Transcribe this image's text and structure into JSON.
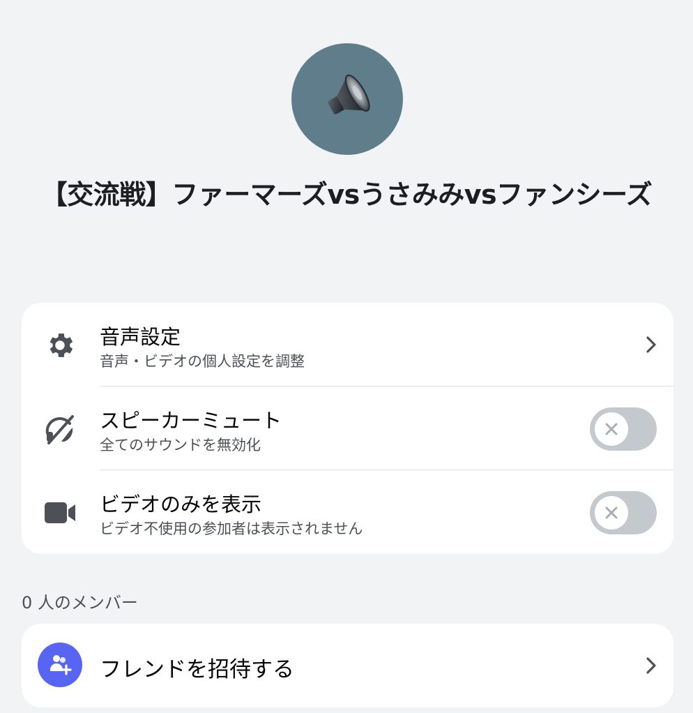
{
  "channel": {
    "title": "【交流戦】ファーマーズvsうさみみvsファンシーズ",
    "icon": "speaker-icon",
    "avatar_color": "#607d8b"
  },
  "settings": [
    {
      "title": "音声設定",
      "subtitle": "音声・ビデオの個人設定を調整",
      "icon": "gear-icon",
      "control": "chevron"
    },
    {
      "title": "スピーカーミュート",
      "subtitle": "全てのサウンドを無効化",
      "icon": "speaker-muted-icon",
      "control": "toggle",
      "enabled": false
    },
    {
      "title": "ビデオのみを表示",
      "subtitle": "ビデオ不使用の参加者は表示されません",
      "icon": "video-camera-icon",
      "control": "toggle",
      "enabled": false
    }
  ],
  "members": {
    "label": "0 人のメンバー"
  },
  "invite": {
    "label": "フレンドを招待する",
    "icon": "add-friend-icon",
    "accent_color": "#5865f2"
  },
  "colors": {
    "background": "#f2f3f5",
    "card": "#ffffff",
    "toggle_off": "#c4c9ce",
    "icon": "#4e5058"
  }
}
